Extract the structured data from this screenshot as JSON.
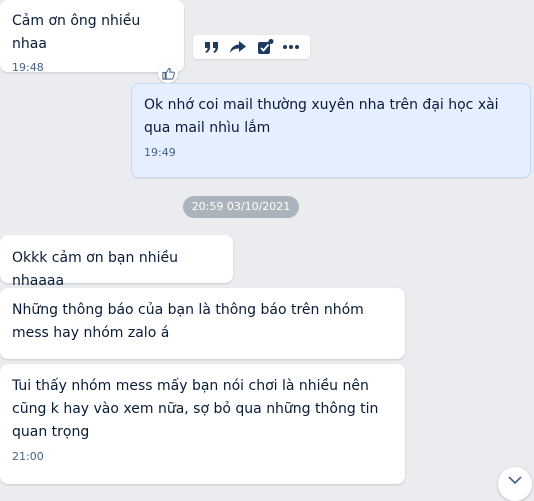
{
  "messages": [
    {
      "text": "Cảm ơn ông nhiều nhaa",
      "time": "19:48",
      "sender": "other"
    },
    {
      "text": "Ok nhớ coi mail thường xuyên nha trên đại học xài qua mail nhìu lắm",
      "time": "19:49",
      "sender": "me"
    },
    {
      "text": "Okkk cảm ơn bạn nhiều nhaaaa",
      "sender": "other"
    },
    {
      "text": "Những thông báo của bạn là thông báo trên nhóm mess hay nhóm zalo á",
      "sender": "other"
    },
    {
      "text": "Tui thấy nhóm mess mấy bạn nói chơi là nhiều nên cũng k hay vào xem nữa, sợ bỏ qua những thông tin quan trọng",
      "time": "21:00",
      "sender": "other"
    }
  ],
  "date_separator": "20:59 03/10/2021",
  "toolbar": {
    "icons": [
      "quote-icon",
      "share-icon",
      "task-check-icon",
      "more-icon"
    ]
  },
  "colors": {
    "background": "#eaecf0",
    "bubble_other": "#ffffff",
    "bubble_me": "#e5efff",
    "text": "#081c36",
    "time": "#476285",
    "date_pill": "#abb4bc",
    "icon": "#1e3a5f"
  }
}
